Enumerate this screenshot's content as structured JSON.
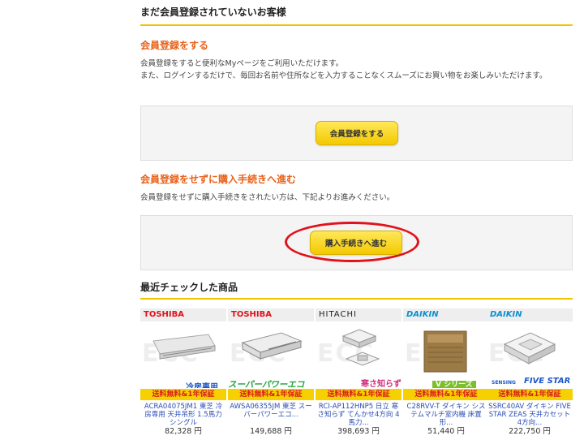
{
  "section": {
    "title": "まだ会員登録されていないお客様"
  },
  "register": {
    "heading": "会員登録をする",
    "line1": "会員登録をすると便利なMyページをご利用いただけます。",
    "line2": "また、ログインするだけで、毎回お名前や住所などを入力することなくスムーズにお買い物をお楽しみいただけます。",
    "button": "会員登録をする"
  },
  "guest": {
    "heading": "会員登録をせずに購入手続きへ進む",
    "text": "会員登録をせずに購入手続きをされたい方は、下記よりお進みください。",
    "button": "購入手続きへ進む"
  },
  "recent": {
    "title": "最近チェックした商品",
    "watermark": "ECC",
    "items": [
      {
        "brand": "TOSHIBA",
        "brand_color": "#e0121b",
        "tag": "冷房専用",
        "ribbon": "送料無料&1年保証",
        "name": "ACRA04075JM1 東芝 冷房専用 天井吊形 1.5馬力 シングル",
        "price": "82,328 円"
      },
      {
        "brand": "TOSHIBA",
        "brand_color": "#e0121b",
        "tag": "スーパーパワーエコ",
        "ribbon": "送料無料&1年保証",
        "name": "AWSA06355JM 東芝 スーパーパワーエコ...",
        "price": "149,688 円"
      },
      {
        "brand": "HITACHI",
        "brand_color": "#222222",
        "tag": "寒さ知らず",
        "ribbon": "送料無料&1年保証",
        "name": "RCI-AP112HNP5 日立 寒さ知らず てんかせ4方向 4馬力...",
        "price": "398,693 円"
      },
      {
        "brand": "DAIKIN",
        "brand_color": "#0a8fd4",
        "tag": "V シリーズ",
        "ribbon": "送料無料&1年保証",
        "name": "C28RVV-T ダイキン システムマルチ室内機 床置形...",
        "price": "51,440 円"
      },
      {
        "brand": "DAIKIN",
        "brand_color": "#0a8fd4",
        "tag": "FIVE STAR",
        "tag_sub": "SENSING",
        "ribbon": "送料無料&1年保証",
        "name": "SSRC40AV ダイキン FIVE STAR ZEAS 天井カセット4方向...",
        "price": "222,750 円"
      }
    ]
  }
}
